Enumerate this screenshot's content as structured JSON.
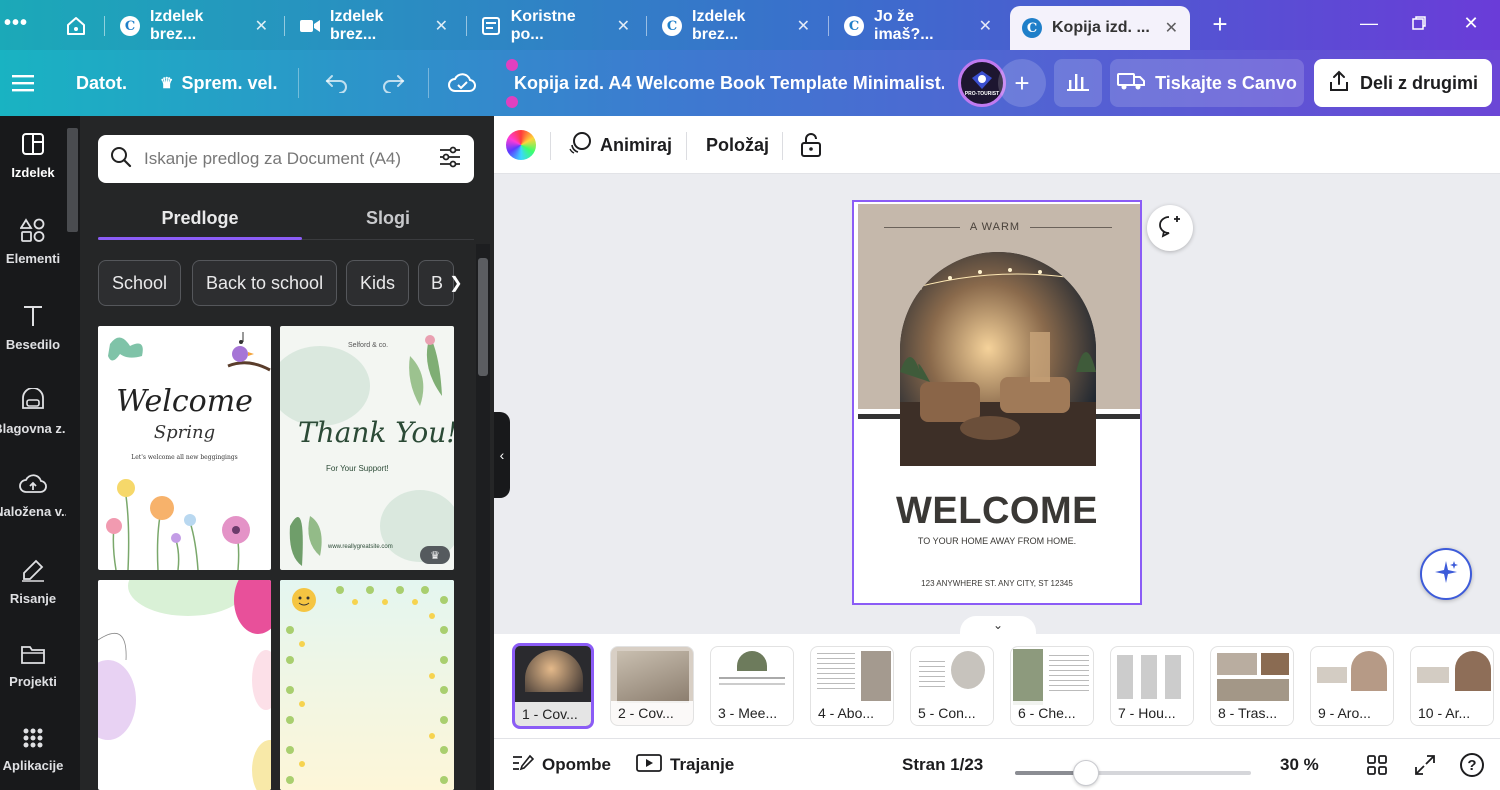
{
  "browser": {
    "menu_icon": "ellipsis-icon",
    "tabs": [
      {
        "title": "Izdelek brez...",
        "icon": "canva-icon",
        "active": false
      },
      {
        "title": "Izdelek brez...",
        "icon": "video-icon",
        "active": false
      },
      {
        "title": "Koristne po...",
        "icon": "form-icon",
        "active": false
      },
      {
        "title": "Izdelek brez...",
        "icon": "canva-icon",
        "active": false
      },
      {
        "title": "Jo že imaš?...",
        "icon": "canva-icon",
        "active": false
      },
      {
        "title": "Kopija izd. ...",
        "icon": "canva-icon",
        "active": true
      }
    ],
    "new_tab_icon": "plus-icon",
    "canva_glyph": "C"
  },
  "toolbar": {
    "menu_icon": "hamburger-icon",
    "file_label": "Datot.",
    "resize_label": "Sprem. vel.",
    "title": "Kopija izd. A4 Welcome Book  Template Minimalist...",
    "avatar_text": "PRO-TOURIST",
    "print_label": "Tiskajte s Canvo",
    "share_label": "Deli z drugimi"
  },
  "sidebar": {
    "items": [
      {
        "label": "Izdelek",
        "icon": "layout-icon",
        "active": true
      },
      {
        "label": "Elementi",
        "icon": "elements-icon",
        "active": false
      },
      {
        "label": "Besedilo",
        "icon": "text-icon",
        "active": false
      },
      {
        "label": "Blagovna z...",
        "icon": "brand-icon",
        "active": false
      },
      {
        "label": "Naložena v...",
        "icon": "cloud-upload-icon",
        "active": false
      },
      {
        "label": "Risanje",
        "icon": "draw-icon",
        "active": false
      },
      {
        "label": "Projekti",
        "icon": "folder-icon",
        "active": false
      },
      {
        "label": "Aplikacije",
        "icon": "apps-icon",
        "active": false
      }
    ]
  },
  "panel": {
    "search_placeholder": "Iskanje predlog za Document (A4)",
    "tabs": [
      "Predloge",
      "Slogi"
    ],
    "chips": [
      "School",
      "Back to school",
      "Kids",
      "B"
    ],
    "templates": [
      {
        "title": "Welcome",
        "subtitle": "Spring",
        "caption": "Let's welcome all new beggingings"
      },
      {
        "brand": "Selford & co.",
        "title": "Thank You!",
        "caption": "For Your Support!",
        "footer": "www.reallygreatsite.com",
        "premium": true
      },
      {},
      {}
    ]
  },
  "context": {
    "animate_label": "Animiraj",
    "position_label": "Položaj"
  },
  "page": {
    "kicker": "A WARM",
    "headline": "WELCOME",
    "subline": "TO YOUR HOME AWAY FROM HOME.",
    "address": "123 ANYWHERE ST. ANY CITY, ST 12345"
  },
  "pages": [
    {
      "label": "1 - Cov..."
    },
    {
      "label": "2 - Cov..."
    },
    {
      "label": "3 - Mee..."
    },
    {
      "label": "4 - Abo..."
    },
    {
      "label": "5 - Con..."
    },
    {
      "label": "6 - Che..."
    },
    {
      "label": "7 - Hou..."
    },
    {
      "label": "8 - Tras..."
    },
    {
      "label": "9 - Aro..."
    },
    {
      "label": "10 - Ar..."
    }
  ],
  "footer": {
    "notes_label": "Opombe",
    "duration_label": "Trajanje",
    "page_indicator": "Stran 1/23",
    "zoom_label": "30 %",
    "zoom_fraction": 0.3
  },
  "colors": {
    "accent": "#8b5cf6",
    "tabbar_start": "#1ba9b8",
    "tabbar_end": "#6a3cd8",
    "sidebar_bg": "#18191b",
    "panel_bg": "#252627"
  }
}
